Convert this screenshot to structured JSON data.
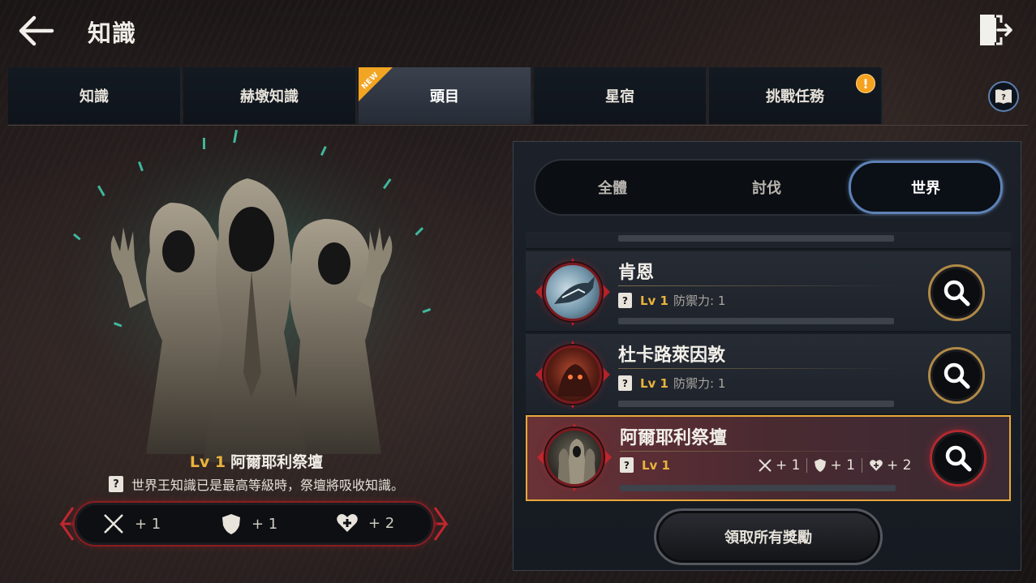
{
  "header": {
    "title": "知識"
  },
  "tabs": [
    {
      "label": "知識"
    },
    {
      "label": "赫墩知識"
    },
    {
      "label": "頭目",
      "badge": "NEW"
    },
    {
      "label": "星宿"
    },
    {
      "label": "挑戰任務",
      "alert": "!"
    }
  ],
  "hero": {
    "level": "Lv 1",
    "name": "阿爾耶利祭壇",
    "desc": "世界王知識已是最高等級時，祭壇將吸收知識。",
    "stats": [
      {
        "icon": "swords-icon",
        "value": "+ 1"
      },
      {
        "icon": "shield-icon",
        "value": "+ 1"
      },
      {
        "icon": "heart-plus-icon",
        "value": "+ 2"
      }
    ]
  },
  "segments": [
    {
      "label": "全體"
    },
    {
      "label": "討伐"
    },
    {
      "label": "世界"
    }
  ],
  "list": [
    {
      "name": "肯恩",
      "level": "Lv 1",
      "info": "防禦力: 1"
    },
    {
      "name": "杜卡路萊因敦",
      "level": "Lv 1",
      "info": "防禦力: 1"
    },
    {
      "name": "阿爾耶利祭壇",
      "level": "Lv 1",
      "stats": [
        "+ 1",
        "+ 1",
        "+ 2"
      ]
    }
  ],
  "claim_button": "領取所有獎勵",
  "question_mark": "?",
  "colors": {
    "accent_gold": "#e9b43c",
    "alert_orange": "#f5a21e",
    "select_border": "#e7a93b",
    "seg_active": "#5d82b7"
  }
}
